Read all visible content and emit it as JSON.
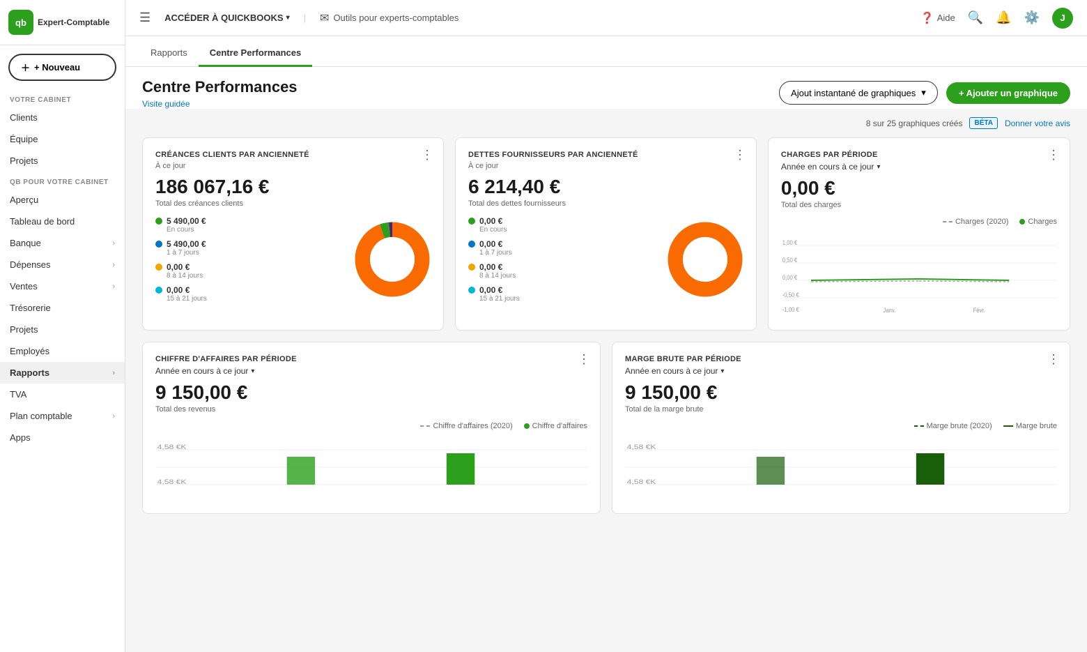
{
  "logo": {
    "initials": "qb",
    "text_line1": "Expert-Comptable"
  },
  "sidebar": {
    "new_button": "+ Nouveau",
    "sections": [
      {
        "label": "VOTRE CABINET",
        "items": [
          {
            "label": "Clients",
            "active": false,
            "has_chevron": false
          },
          {
            "label": "Équipe",
            "active": false,
            "has_chevron": false
          },
          {
            "label": "Projets",
            "active": false,
            "has_chevron": false
          }
        ]
      },
      {
        "label": "QB POUR VOTRE CABINET",
        "items": [
          {
            "label": "Aperçu",
            "active": false,
            "has_chevron": false
          },
          {
            "label": "Tableau de bord",
            "active": false,
            "has_chevron": false
          },
          {
            "label": "Banque",
            "active": false,
            "has_chevron": true
          },
          {
            "label": "Dépenses",
            "active": false,
            "has_chevron": true
          },
          {
            "label": "Ventes",
            "active": false,
            "has_chevron": true
          },
          {
            "label": "Trésorerie",
            "active": false,
            "has_chevron": false
          },
          {
            "label": "Projets",
            "active": false,
            "has_chevron": false
          },
          {
            "label": "Employés",
            "active": false,
            "has_chevron": false
          },
          {
            "label": "Rapports",
            "active": true,
            "has_chevron": true
          },
          {
            "label": "TVA",
            "active": false,
            "has_chevron": false
          },
          {
            "label": "Plan comptable",
            "active": false,
            "has_chevron": true
          },
          {
            "label": "Apps",
            "active": false,
            "has_chevron": false
          }
        ]
      }
    ]
  },
  "topnav": {
    "quickbooks_label": "ACCÉDER À QUICKBOOKS",
    "tools_label": "Outils pour experts-comptables",
    "aide_label": "Aide",
    "avatar_letter": "J"
  },
  "tabs": [
    {
      "label": "Rapports",
      "active": false
    },
    {
      "label": "Centre Performances",
      "active": true
    }
  ],
  "page": {
    "title": "Centre Performances",
    "visite_guidee": "Visite guidée",
    "meta_text": "8 sur 25 graphiques créés",
    "beta_label": "BÉTA",
    "donner_avis": "Donner votre avis",
    "snapshot_btn": "Ajout instantané de graphiques",
    "add_graph_btn": "+ Ajouter un graphique"
  },
  "cards": {
    "creances": {
      "title": "CRÉANCES CLIENTS PAR ANCIENNETÉ",
      "subtitle": "À ce jour",
      "amount": "186 067,16 €",
      "amount_label": "Total des créances clients",
      "legend": [
        {
          "color": "#2ca01c",
          "value": "5 490,00 €",
          "label": "En cours"
        },
        {
          "color": "#0077c5",
          "value": "5 490,00 €",
          "label": "1 à 7 jours"
        },
        {
          "color": "#f0a500",
          "value": "0,00 €",
          "label": "8 à 14 jours"
        },
        {
          "color": "#00b8d4",
          "value": "0,00 €",
          "label": "15 à 21 jours"
        }
      ],
      "donut": {
        "segments": [
          {
            "color": "#f96a00",
            "percent": 94
          },
          {
            "color": "#2ca01c",
            "percent": 3
          },
          {
            "color": "#0077c5",
            "percent": 2
          },
          {
            "color": "#4c1f7a",
            "percent": 1
          }
        ]
      }
    },
    "dettes": {
      "title": "DETTES FOURNISSEURS PAR ANCIENNETÉ",
      "subtitle": "À ce jour",
      "amount": "6 214,40 €",
      "amount_label": "Total des dettes fournisseurs",
      "legend": [
        {
          "color": "#2ca01c",
          "value": "0,00 €",
          "label": "En cours"
        },
        {
          "color": "#0077c5",
          "value": "0,00 €",
          "label": "1 à 7 jours"
        },
        {
          "color": "#f0a500",
          "value": "0,00 €",
          "label": "8 à 14 jours"
        },
        {
          "color": "#00b8d4",
          "value": "0,00 €",
          "label": "15 à 21 jours"
        }
      ],
      "donut": {
        "segments": [
          {
            "color": "#f96a00",
            "percent": 98
          },
          {
            "color": "#f0f0f0",
            "percent": 2
          }
        ]
      }
    },
    "charges": {
      "title": "CHARGES PAR PÉRIODE",
      "period": "Année en cours à ce jour",
      "amount": "0,00 €",
      "amount_label": "Total des charges",
      "legend_2020": "Charges (2020)",
      "legend_current": "Charges",
      "y_labels": [
        "1,00 €",
        "0,50 €",
        "0,00 €",
        "-0,50 €",
        "-1,00 €"
      ],
      "x_labels": [
        "Janv.",
        "Févr."
      ]
    },
    "chiffre_affaires": {
      "title": "CHIFFRE D'AFFAIRES PAR PÉRIODE",
      "period": "Année en cours à ce jour",
      "amount": "9 150,00 €",
      "amount_label": "Total des revenus",
      "legend_2020": "Chiffre d'affaires (2020)",
      "legend_current": "Chiffre d'affaires",
      "y_labels": [
        "4,58 €K",
        "4,58 €K"
      ]
    },
    "marge_brute": {
      "title": "MARGE BRUTE PAR PÉRIODE",
      "period": "Année en cours à ce jour",
      "amount": "9 150,00 €",
      "amount_label": "Total de la marge brute",
      "legend_2020": "Marge brute (2020)",
      "legend_current": "Marge brute",
      "y_labels": [
        "4,58 €K",
        "4,58 €K"
      ]
    }
  }
}
